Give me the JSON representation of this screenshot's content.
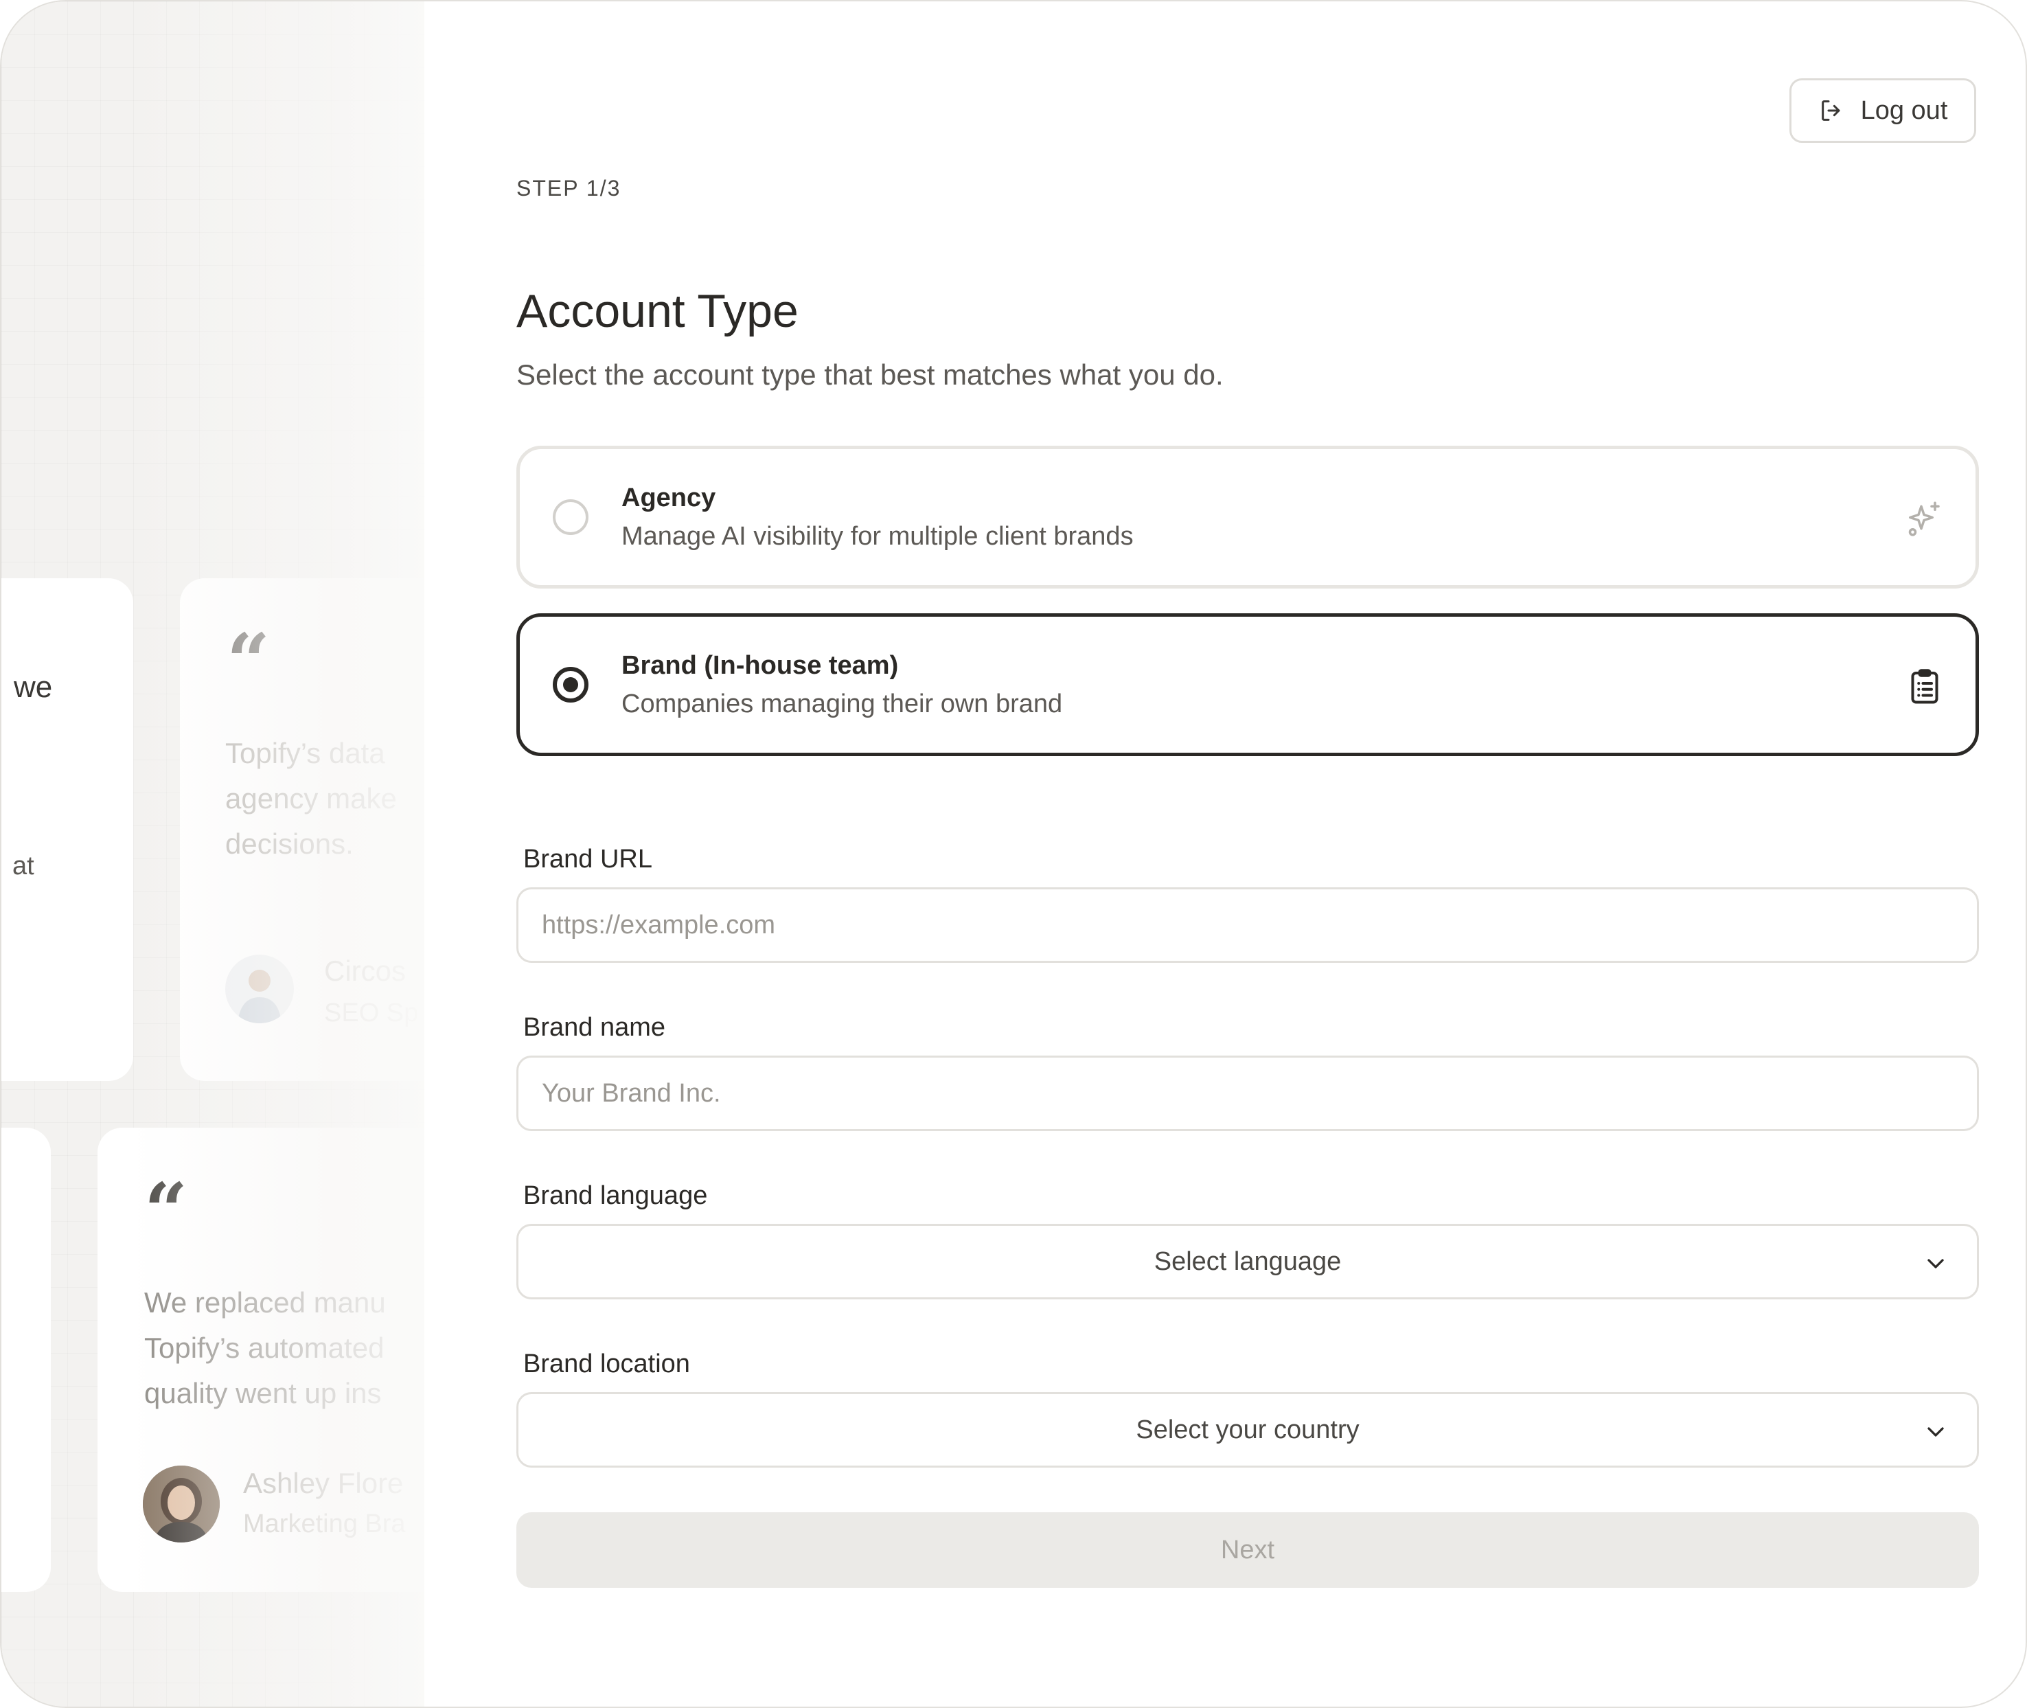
{
  "header": {
    "logout_label": "Log out"
  },
  "step": "STEP 1/3",
  "title": "Account Type",
  "subtitle": "Select the account type that best matches what you do.",
  "options": [
    {
      "title": "Agency",
      "description": "Manage AI visibility for multiple client brands",
      "icon": "sparkles-icon",
      "selected": false
    },
    {
      "title": "Brand (In-house team)",
      "description": "Companies managing their own brand",
      "icon": "clipboard-list-icon",
      "selected": true
    }
  ],
  "form": {
    "url": {
      "label": "Brand URL",
      "placeholder": "https://example.com",
      "value": ""
    },
    "name": {
      "label": "Brand name",
      "placeholder": "Your Brand Inc.",
      "value": ""
    },
    "language": {
      "label": "Brand language",
      "selected": "Select language"
    },
    "location": {
      "label": "Brand location",
      "selected": "Select your country"
    }
  },
  "next_label": "Next",
  "testimonials": {
    "partial_card_1": {
      "line1": "we",
      "line2": "at"
    },
    "card_2": {
      "quote_mark": "“",
      "text": "Topify’s data\nagency make\ndecisions.",
      "author": "Circos",
      "role": "SEO Sp"
    },
    "card_3": {
      "quote_mark": "“",
      "text": "We replaced manu\nTopify’s automated\nquality went up ins",
      "author": "Ashley Flore",
      "role": "Marketing Bra"
    }
  },
  "colors": {
    "primary_text": "#2b2926",
    "muted_text": "#5c5955",
    "border": "#e2e0dc",
    "selected_border": "#2b2926",
    "disabled_button_bg": "#ebeae7",
    "left_panel_bg": "#f3f2f0"
  }
}
